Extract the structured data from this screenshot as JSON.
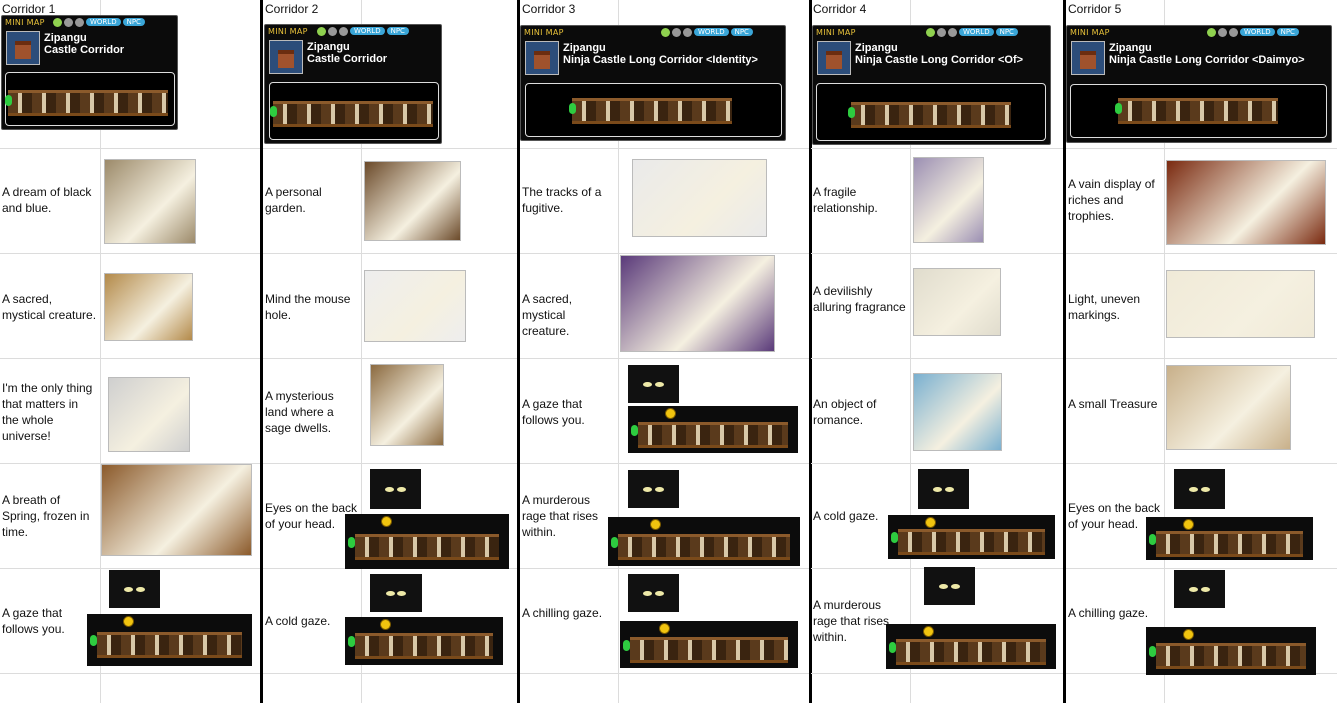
{
  "headers": [
    "Corridor 1",
    "Corridor 2",
    "Corridor 3",
    "Corridor 4",
    "Corridor 5"
  ],
  "minimap": {
    "title": "MINI MAP",
    "world_label": "WORLD",
    "npc_label": "NPC",
    "region": "Zipangu",
    "maps": [
      "Castle Corridor",
      "Castle Corridor",
      "Ninja Castle Long Corridor <Identity>",
      "Ninja Castle Long Corridor <Of>",
      "Ninja Castle Long Corridor <Daimyo>"
    ]
  },
  "clues": [
    [
      "A dream of black and blue.",
      "A sacred, mystical creature.",
      "I'm the only thing that matters in the whole universe!",
      "A breath of Spring, frozen in time.",
      "A gaze that follows you."
    ],
    [
      "A personal garden.",
      "Mind the mouse hole.",
      "A mysterious land where a sage dwells.",
      "Eyes on the back of your head.",
      "A cold gaze."
    ],
    [
      "The tracks of a fugitive.",
      "A sacred, mystical creature.",
      "A gaze that follows you.",
      "A murderous rage that rises within.",
      "A chilling gaze."
    ],
    [
      "A fragile relationship.",
      "A devilishly alluring fragrance",
      "An object of romance.",
      "A cold gaze.",
      "A murderous rage that rises within."
    ],
    [
      "A vain display of riches and trophies.",
      "Light, uneven markings.",
      "A small Treasure",
      "Eyes on the back of your head.",
      "A chilling gaze."
    ]
  ],
  "thumb_names": [
    [
      "blue-vase-image",
      "creature-figurines-image",
      "portrait-image",
      "spring-flowers-image",
      "gaze-image"
    ],
    [
      "garden-image",
      "mouse-hole-image",
      "vase-image",
      "eyes-image",
      "gaze-image"
    ],
    [
      "tracks-image",
      "sacred-creature-scroll-image",
      "gaze-image",
      "rage-image",
      "gaze-image"
    ],
    [
      "painting-image",
      "fragrance-jars-image",
      "romance-flowers-image",
      "gaze-image",
      "rage-image"
    ],
    [
      "treasure-display-image",
      "calligraphy-image",
      "small-treasure-image",
      "eyes-image",
      "gaze-image"
    ]
  ],
  "colors": {
    "divider": "#000000",
    "grid": "#dcdcdc",
    "player_dot": "#2ecc40",
    "npc_dot": "#f1c40f"
  }
}
